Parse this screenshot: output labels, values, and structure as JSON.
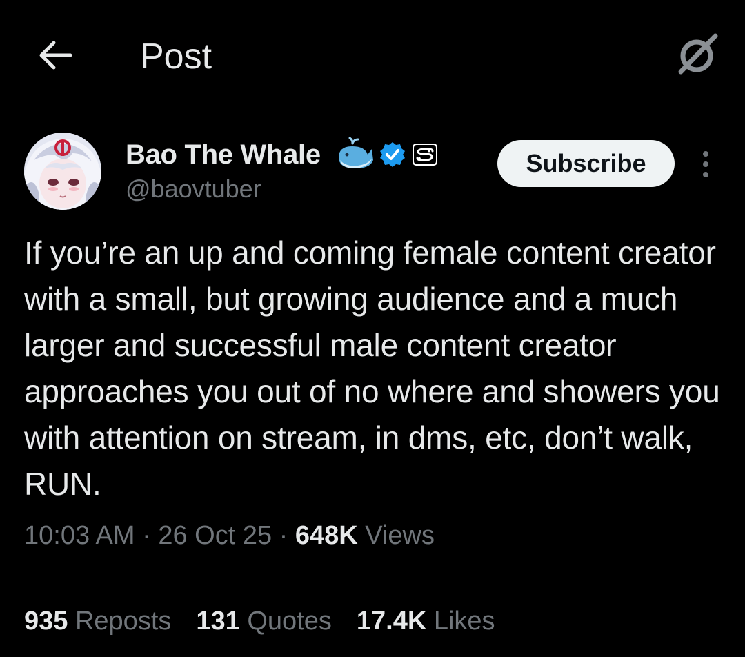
{
  "header": {
    "title": "Post",
    "back_icon": "arrow-left-icon",
    "grok_icon": "grok-icon"
  },
  "post": {
    "author": {
      "name": "Bao The Whale",
      "handle": "@baovtuber",
      "emoji_icon": "whale-icon",
      "verified_icon": "verified-badge-icon",
      "affiliate_icon": "ss-badge-icon",
      "verified_color": "#1d9bf0"
    },
    "subscribe_label": "Subscribe",
    "more_icon": "more-vertical-icon",
    "text": "If you’re an up and coming female content creator with a small, but growing audience and a much larger and successful male content creator approaches you out of no where and showers you with attention on stream, in dms, etc, don’t walk, RUN.",
    "time": "10:03 AM",
    "date": "26 Oct 25",
    "views_count": "648K",
    "views_label": "Views",
    "separator": "·"
  },
  "stats": [
    {
      "count": "935",
      "label": "Reposts"
    },
    {
      "count": "131",
      "label": "Quotes"
    },
    {
      "count": "17.4K",
      "label": "Likes"
    }
  ],
  "colors": {
    "background": "#000000",
    "text": "#e7e9ea",
    "muted": "#71767b",
    "divider": "#2f3336"
  }
}
